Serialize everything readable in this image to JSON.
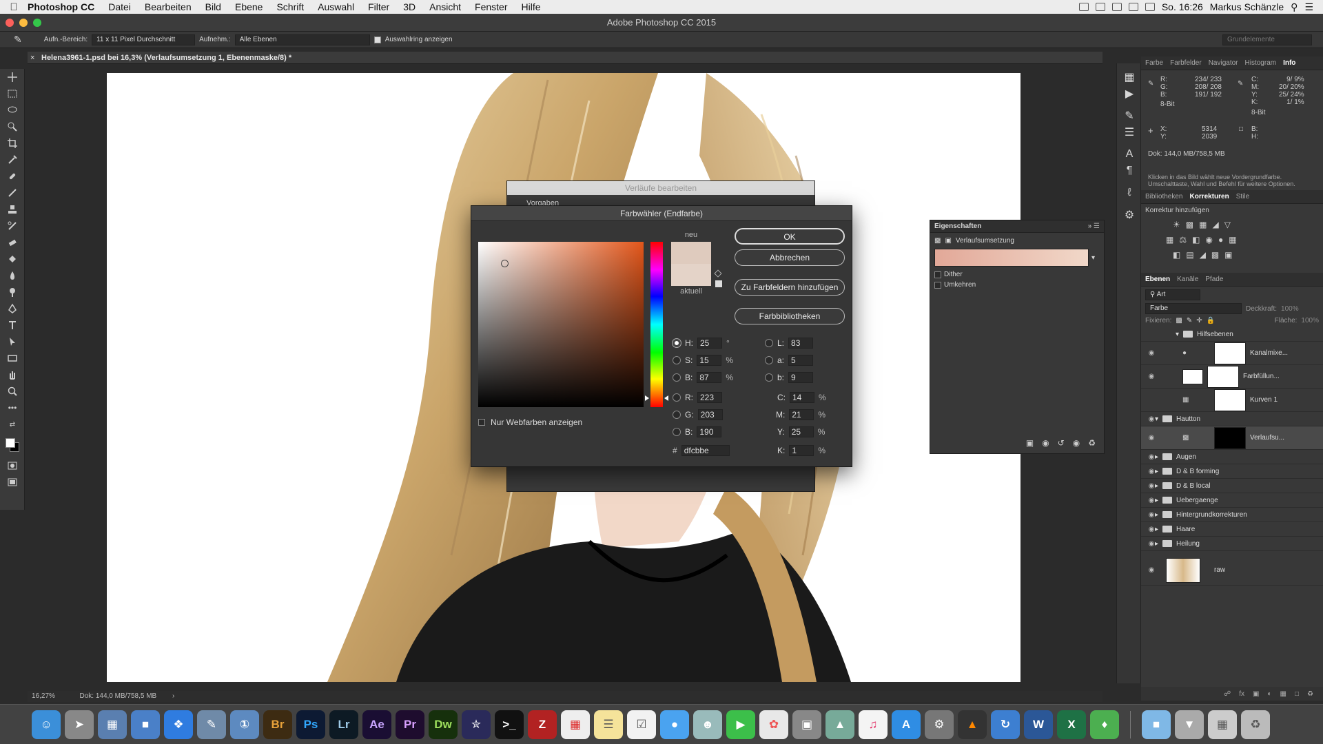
{
  "menubar": {
    "app": "Photoshop CC",
    "items": [
      "Datei",
      "Bearbeiten",
      "Bild",
      "Ebene",
      "Schrift",
      "Auswahl",
      "Filter",
      "3D",
      "Ansicht",
      "Fenster",
      "Hilfe"
    ],
    "clock": "So. 16:26",
    "user": "Markus Schänzle"
  },
  "window": {
    "title": "Adobe Photoshop CC 2015"
  },
  "options": {
    "label_sample": "Aufn.-Bereich:",
    "sample_value": "11 x 11 Pixel Durchschnitt",
    "label_sample2": "Aufnehm.:",
    "sample2_value": "Alle Ebenen",
    "show_ring": "Auswahlring anzeigen",
    "workspace": "Grundelemente"
  },
  "document": {
    "tab": "Helena3961-1.psd bei 16,3% (Verlaufsumsetzung 1, Ebenenmaske/8) *",
    "zoom": "16,27%",
    "doc_size": "Dok: 144,0 MB/758,5 MB"
  },
  "info_panel": {
    "tabs": [
      "Farbe",
      "Farbfelder",
      "Navigator",
      "Histogram",
      "Info"
    ],
    "r": "234/ 233",
    "g": "208/ 208",
    "b": "191/ 192",
    "c": "9/ 9%",
    "m": "20/ 20%",
    "y": "25/ 24%",
    "k": "1/ 1%",
    "bit1": "8-Bit",
    "bit2": "8-Bit",
    "x": "5314",
    "y_coord": "2039",
    "doc": "Dok: 144,0 MB/758,5 MB",
    "hint": "Klicken in das Bild wählt neue Vordergrundfarbe. Umschalttaste, Wahl und Befehl für weitere Optionen."
  },
  "adjust_panel": {
    "tabs": [
      "Bibliotheken",
      "Korrekturen",
      "Stile"
    ],
    "heading": "Korrektur hinzufügen"
  },
  "layers_panel": {
    "tabs": [
      "Ebenen",
      "Kanäle",
      "Pfade"
    ],
    "kind": "Art",
    "blend": "Farbe",
    "opacity_label": "Deckkraft:",
    "opacity": "100%",
    "fix_label": "Fixieren:",
    "fill_label": "Fläche:",
    "fill": "100%",
    "groups": [
      {
        "name": "Hilfsebenen"
      },
      {
        "name": "Kanalmixe..."
      },
      {
        "name": "Farbfüllun..."
      },
      {
        "name": "Kurven 1"
      },
      {
        "name": "Hautton"
      },
      {
        "name": "Verlaufsu..."
      },
      {
        "name": "Augen"
      },
      {
        "name": "D & B forming"
      },
      {
        "name": "D & B local"
      },
      {
        "name": "Uebergaenge"
      },
      {
        "name": "Hintergrundkorrekturen"
      },
      {
        "name": "Haare"
      },
      {
        "name": "Heilung"
      },
      {
        "name": "raw"
      }
    ]
  },
  "properties": {
    "title": "Eigenschaften",
    "subtitle": "Verlaufsumsetzung",
    "dither": "Dither",
    "reverse": "Umkehren",
    "gradient_from": "#e2a898",
    "gradient_to": "#f1d8c9"
  },
  "gradient_dialog": {
    "title": "Verläufe bearbeiten",
    "presets": "Vorgaben"
  },
  "picker": {
    "title": "Farbwähler (Endfarbe)",
    "ok": "OK",
    "cancel": "Abbrechen",
    "add_swatch": "Zu Farbfeldern hinzufügen",
    "libraries": "Farbbibliotheken",
    "new_label": "neu",
    "current_label": "aktuell",
    "web_only": "Nur Webfarben anzeigen",
    "new_color": "#dfcbbe",
    "current_color": "#e4d3c8",
    "h": "25",
    "s": "15",
    "b": "87",
    "r": "223",
    "g": "203",
    "bl": "190",
    "l": "83",
    "a": "5",
    "lab_b": "9",
    "c": "14",
    "m": "21",
    "y": "25",
    "k": "1",
    "hex": "dfcbbe",
    "deg": "°",
    "pct": "%"
  },
  "dock": {
    "apps": [
      "Br",
      "Ps",
      "Lr",
      "Ae",
      "Pr",
      "Dw",
      "W",
      "X"
    ]
  }
}
